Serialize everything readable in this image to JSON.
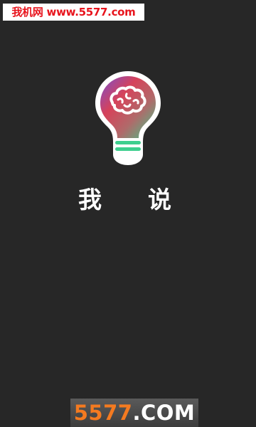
{
  "watermark_top": {
    "text": "我机网 www.5577.com"
  },
  "app": {
    "logo_icon": "lightbulb-brain-icon",
    "name_chars": [
      "我",
      "说"
    ]
  },
  "watermark_bottom": {
    "number": "5577",
    "domain": ".COM"
  },
  "colors": {
    "background": "#272727",
    "watermark_red": "#e8141d",
    "watermark_orange": "#f47a20",
    "bulb_base_green": "#3ecf8e"
  }
}
